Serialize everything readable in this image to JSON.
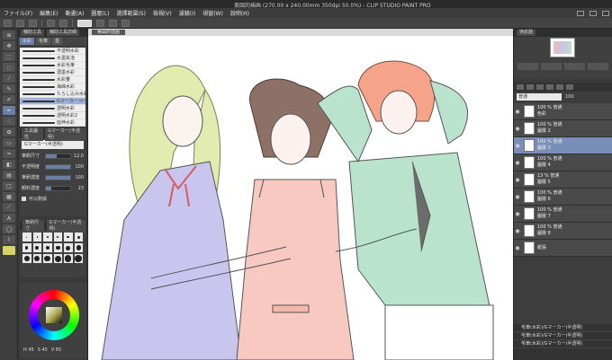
{
  "app": {
    "title": "美図的插画 (270.00 x 240.00mm 350dpi 50.0%) - CLIP STUDIO PAINT PRO"
  },
  "menubar": {
    "items": [
      "ファイル(F)",
      "編集(E)",
      "動畫(A)",
      "圖層(L)",
      "選擇範圍(S)",
      "檢視(V)",
      "濾鏡(I)",
      "視窗(W)",
      "說明(H)"
    ]
  },
  "left_tabs": [
    "輔助工具",
    "輔助工具詳細"
  ],
  "subtool": {
    "tabs": [
      "水彩",
      "毛筆",
      "墨"
    ],
    "brushes": [
      "不透明水彩",
      "水墨氣泡",
      "水彩毛筆",
      "濃墨水彩",
      "水彩暈",
      "海綿水彩",
      "たらし込み水彩",
      "Gマーカーペース",
      "透明水彩",
      "透明水彩2",
      "延伸水彩"
    ]
  },
  "tool_property": {
    "tabs": [
      "工具屬性",
      "Gマーカー(半透明)"
    ],
    "preset": "Gマーカー(半透明)",
    "props": [
      {
        "label": "筆刷尺寸",
        "value": "12.0",
        "fill": 0.45
      },
      {
        "label": "不透明度",
        "value": "100",
        "fill": 1.0
      },
      {
        "label": "筆刷濃度",
        "value": "100",
        "fill": 1.0
      },
      {
        "label": "顏料濃度",
        "value": "23",
        "fill": 0.23
      }
    ],
    "checkbox": "可以數據"
  },
  "brush_size": {
    "tabs": [
      "筆刷尺寸",
      "Gマーカー(半透明)"
    ],
    "sizes": [
      "0.7",
      "1",
      "1.5",
      "2",
      "3",
      "4",
      "5",
      "6",
      "7",
      "8",
      "10",
      "12",
      "15",
      "17",
      "20",
      "25",
      "30",
      "40"
    ]
  },
  "color": {
    "values": [
      "H 45",
      "S 45",
      "V 65"
    ]
  },
  "document": {
    "tab": "美図的插画"
  },
  "navigator": {
    "tab": "導航器"
  },
  "layers": {
    "blend_mode": "普通",
    "opacity": "100",
    "items": [
      {
        "name": "色彩",
        "opacity": "100 % 普通",
        "selected": false
      },
      {
        "name": "圖層 2",
        "opacity": "100 % 普通",
        "selected": false
      },
      {
        "name": "圖層 3",
        "opacity": "100 % 普通",
        "selected": true
      },
      {
        "name": "圖層 4",
        "opacity": "100 % 普通",
        "selected": false
      },
      {
        "name": "圖層 5",
        "opacity": "13 % 普通",
        "selected": false
      },
      {
        "name": "圖層 6",
        "opacity": "100 % 普通",
        "selected": false
      },
      {
        "name": "圖層 7",
        "opacity": "100 % 普通",
        "selected": false
      },
      {
        "name": "圖層 8",
        "opacity": "100 % 普通",
        "selected": false
      },
      {
        "name": "紙張",
        "opacity": "",
        "selected": false
      }
    ]
  },
  "bottom_strip": [
    "毛筆(水彩)/Gマーカー(半透明)",
    "毛筆(水彩)/Gマーカー(半透明)",
    "毛筆(水彩)/Gマーカー(半透明)"
  ]
}
